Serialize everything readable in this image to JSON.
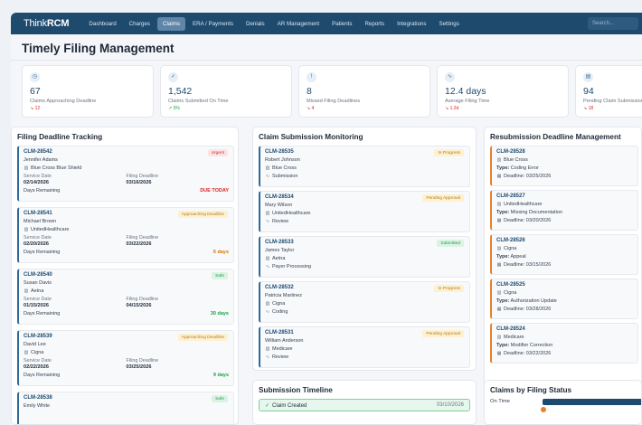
{
  "app": {
    "brand_prefix": "Think",
    "brand_suffix": "RCM"
  },
  "nav": [
    "Dashboard",
    "Charges",
    "Claims",
    "ERA / Payments",
    "Denials",
    "AR Management",
    "Patients",
    "Reports",
    "Integrations",
    "Settings"
  ],
  "nav_active": "Claims",
  "search_placeholder": "Search...",
  "page_title": "Timely Filing Management",
  "stats": [
    {
      "icon": "clock-icon",
      "glyph": "◷",
      "value": "67",
      "label": "Claims Approaching Deadline",
      "trend": "↘ 12",
      "dir": "down"
    },
    {
      "icon": "check-circle-icon",
      "glyph": "✓",
      "value": "1,542",
      "label": "Claims Submitted On Time",
      "trend": "↗ 5%",
      "dir": "up"
    },
    {
      "icon": "alert-circle-icon",
      "glyph": "!",
      "value": "8",
      "label": "Missed Filing Deadlines",
      "trend": "↘ 4",
      "dir": "down"
    },
    {
      "icon": "activity-icon",
      "glyph": "∿",
      "value": "12.4 days",
      "label": "Average Filing Time",
      "trend": "↘ 1.2d",
      "dir": "down"
    },
    {
      "icon": "document-icon",
      "glyph": "▤",
      "value": "94",
      "label": "Pending Claim Submission",
      "trend": "↘ 18",
      "dir": "down"
    }
  ],
  "tracking": {
    "title": "Filing Deadline Tracking",
    "service_label": "Service Date",
    "filing_label": "Filing Deadline",
    "days_label": "Days Remaining",
    "items": [
      {
        "id": "CLM-28542",
        "patient": "Jennifer Adams",
        "payer": "Blue Cross Blue Shield",
        "badge": "Urgent",
        "badge_class": "b-red",
        "service": "02/14/2026",
        "filing": "03/16/2026",
        "days": "DUE TODAY",
        "days_class": "r-red"
      },
      {
        "id": "CLM-28541",
        "patient": "Michael Brown",
        "payer": "UnitedHealthcare",
        "badge": "Approaching Deadline",
        "badge_class": "b-yel",
        "service": "02/20/2026",
        "filing": "03/22/2026",
        "days": "6 days",
        "days_class": "r-ora"
      },
      {
        "id": "CLM-28540",
        "patient": "Susan Davis",
        "payer": "Aetna",
        "badge": "Safe",
        "badge_class": "b-grn",
        "service": "01/15/2026",
        "filing": "04/15/2026",
        "days": "30 days",
        "days_class": "r-grn"
      },
      {
        "id": "CLM-28539",
        "patient": "David Lee",
        "payer": "Cigna",
        "badge": "Approaching Deadline",
        "badge_class": "b-yel",
        "service": "02/22/2026",
        "filing": "03/25/2026",
        "days": "9 days",
        "days_class": "r-grn"
      },
      {
        "id": "CLM-28538",
        "patient": "Emily White",
        "payer": "",
        "badge": "Safe",
        "badge_class": "b-grn",
        "service": "",
        "filing": "",
        "days": "",
        "days_class": ""
      }
    ]
  },
  "monitoring": {
    "title": "Claim Submission Monitoring",
    "items": [
      {
        "id": "CLM-28535",
        "patient": "Robert Johnson",
        "payer": "Blue Cross",
        "stage": "Submission",
        "badge": "In Progress",
        "badge_class": "b-yel"
      },
      {
        "id": "CLM-28534",
        "patient": "Mary Wilson",
        "payer": "UnitedHealthcare",
        "stage": "Review",
        "badge": "Pending Approval",
        "badge_class": "b-yel"
      },
      {
        "id": "CLM-28533",
        "patient": "James Taylor",
        "payer": "Aetna",
        "stage": "Payer Processing",
        "badge": "Submitted",
        "badge_class": "b-grn"
      },
      {
        "id": "CLM-28532",
        "patient": "Patricia Martinez",
        "payer": "Cigna",
        "stage": "Coding",
        "badge": "In Progress",
        "badge_class": "b-yel"
      },
      {
        "id": "CLM-28531",
        "patient": "William Anderson",
        "payer": "Medicare",
        "stage": "Review",
        "badge": "Pending Approval",
        "badge_class": "b-yel"
      }
    ]
  },
  "resubmission": {
    "title": "Resubmission Deadline Management",
    "type_label": "Type:",
    "deadline_label": "Deadline:",
    "items": [
      {
        "id": "CLM-28528",
        "payer": "Blue Cross",
        "type": "Coding Error",
        "deadline": "03/25/2026"
      },
      {
        "id": "CLM-28527",
        "payer": "UnitedHealthcare",
        "type": "Missing Documentation",
        "deadline": "03/20/2026"
      },
      {
        "id": "CLM-28526",
        "payer": "Cigna",
        "type": "Appeal",
        "deadline": "03/15/2026"
      },
      {
        "id": "CLM-28525",
        "payer": "Cigna",
        "type": "Authorization Update",
        "deadline": "03/28/2026"
      },
      {
        "id": "CLM-28524",
        "payer": "Medicare",
        "type": "Modifier Correction",
        "deadline": "03/22/2026"
      }
    ]
  },
  "timeline": {
    "title": "Submission Timeline",
    "item_label": "Claim Created",
    "item_date": "03/10/2026"
  },
  "filing_status": {
    "title": "Claims by Filing Status",
    "row_label": "On Time",
    "on_time_fraction": 0.92
  }
}
